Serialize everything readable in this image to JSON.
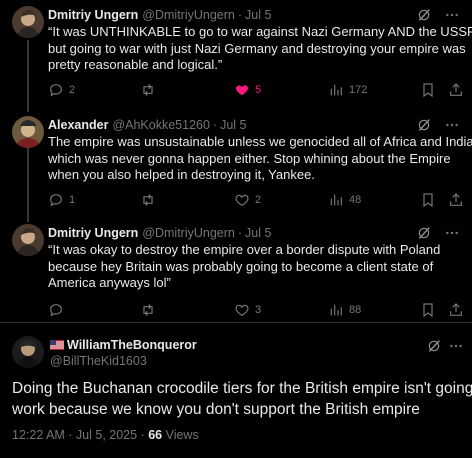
{
  "colors": {
    "background": "#000000",
    "text": "#e7e9ea",
    "muted": "#71767b",
    "like": "#f91880",
    "divider": "#2f3336"
  },
  "replies": [
    {
      "name": "Dmitriy Ungern",
      "handle": "@DmitriyUngern",
      "time": "Jul 5",
      "lines": [
        "“It was UNTHINKABLE to go to war against Nazi Germany AND the USSR,",
        "but going to war with just Nazi Germany and destroying your empire was",
        "pretty reasonable and logical.”"
      ],
      "reply_count": "2",
      "repost_count": "",
      "like_count": "5",
      "view_count": "172",
      "liked": true
    },
    {
      "name": "Alexander",
      "handle": "@AhKokke51260",
      "time": "Jul 5",
      "lines": [
        "The empire was unsustainable unless we genocided all of Africa and India,",
        "which was never gonna happen either. Stop whining about the Empire",
        "when you also helped in destroying it, Yankee."
      ],
      "reply_count": "1",
      "repost_count": "",
      "like_count": "2",
      "view_count": "48",
      "liked": false
    },
    {
      "name": "Dmitriy Ungern",
      "handle": "@DmitriyUngern",
      "time": "Jul 5",
      "lines": [
        "“It was okay to destroy the empire over a border dispute with Poland",
        "because hey Britain was probably going to become a client state of",
        "America anyways lol”"
      ],
      "reply_count": "",
      "repost_count": "",
      "like_count": "3",
      "view_count": "88",
      "liked": false
    }
  ],
  "main": {
    "name": "WilliamTheBonqueror",
    "handle": "@BillTheKid1603",
    "lines": [
      "Doing the Buchanan crocodile tiers for the British empire isn't going to",
      "work because we know you don't support the British empire"
    ],
    "timestamp": "12:22 AM · Jul 5, 2025 · ",
    "views_number": "66",
    "views_label": " Views"
  },
  "separator": "·",
  "icons": {
    "reply": "comment-bubble-icon",
    "repost": "repost-arrows-icon",
    "like": "heart-icon",
    "views": "bar-chart-icon",
    "bookmark": "bookmark-icon",
    "share": "share-upload-icon",
    "grok": "grok-slash-icon",
    "more": "more-dots-icon"
  }
}
